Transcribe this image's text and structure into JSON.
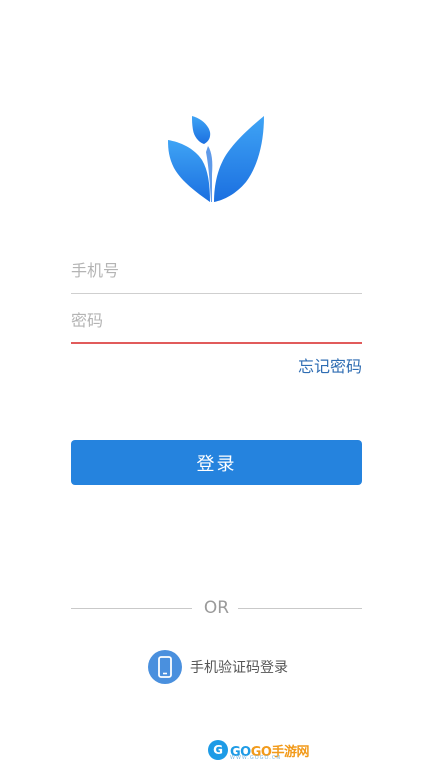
{
  "login": {
    "phone_placeholder": "手机号",
    "password_placeholder": "密码",
    "forgot_password": "忘记密码",
    "login_button": "登录",
    "or_divider": "OR",
    "sms_login": "手机验证码登录"
  },
  "watermark": {
    "brand_prefix": "GO",
    "brand_suffix": "GO手游网",
    "url": "WWW.GOGO.CN"
  },
  "colors": {
    "primary": "#2583de",
    "link": "#2f6db3",
    "active_underline": "#e15b5b",
    "logo_gradient_top": "#3fa4f5",
    "logo_gradient_bottom": "#1b6fe0"
  },
  "icons": {
    "logo": "leaf-book-logo",
    "sms": "phone-icon"
  }
}
